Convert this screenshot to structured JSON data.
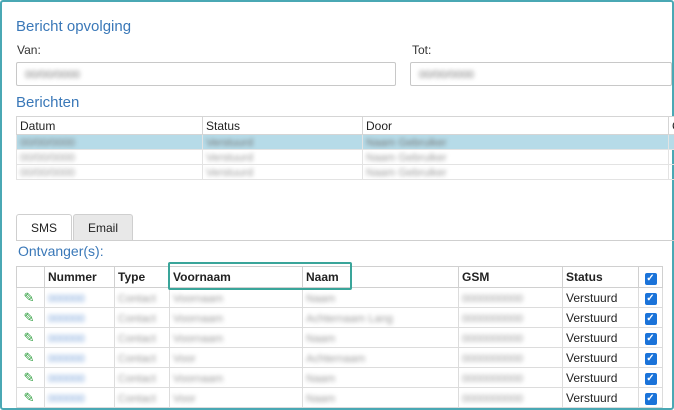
{
  "header": {
    "title": "Bericht opvolging",
    "van_label": "Van:",
    "tot_label": "Tot:",
    "van_value": "00/00/0000",
    "tot_value": "00/00/0000"
  },
  "berichten": {
    "title": "Berichten",
    "columns": [
      "Datum",
      "Status",
      "Door",
      "C"
    ],
    "rows": [
      {
        "datum": "00/00/0000",
        "status": "Verstuurd",
        "door": "Naam Gebruiker",
        "selected": true
      },
      {
        "datum": "00/00/0000",
        "status": "Verstuurd",
        "door": "Naam Gebruiker",
        "selected": false
      },
      {
        "datum": "00/00/0000",
        "status": "Verstuurd",
        "door": "Naam Gebruiker",
        "selected": false
      }
    ]
  },
  "tabs": {
    "sms": "SMS",
    "email": "Email"
  },
  "ontvangers": {
    "title": "Ontvanger(s):",
    "columns": {
      "nummer": "Nummer",
      "type": "Type",
      "voornaam": "Voornaam",
      "naam": "Naam",
      "gsm": "GSM",
      "status": "Status"
    },
    "rows": [
      {
        "nummer": "000000",
        "type": "Contact",
        "voornaam": "Voornaam",
        "naam": "Naam",
        "gsm": "0000000000",
        "status": "Verstuurd"
      },
      {
        "nummer": "000000",
        "type": "Contact",
        "voornaam": "Voornaam",
        "naam": "Achternaam Lang",
        "gsm": "0000000000",
        "status": "Verstuurd"
      },
      {
        "nummer": "000000",
        "type": "Contact",
        "voornaam": "Voornaam",
        "naam": "Naam",
        "gsm": "0000000000",
        "status": "Verstuurd"
      },
      {
        "nummer": "000000",
        "type": "Contact",
        "voornaam": "Voor",
        "naam": "Achternaam",
        "gsm": "0000000000",
        "status": "Verstuurd"
      },
      {
        "nummer": "000000",
        "type": "Contact",
        "voornaam": "Voornaam",
        "naam": "Naam",
        "gsm": "0000000000",
        "status": "Verstuurd"
      },
      {
        "nummer": "000000",
        "type": "Contact",
        "voornaam": "Voor",
        "naam": "Naam",
        "gsm": "0000000000",
        "status": "Verstuurd"
      }
    ]
  },
  "colors": {
    "accent": "#3a78b8",
    "frame": "#4aa8b4",
    "selected_row": "#b6dbe8",
    "highlight_box": "#3aa59a",
    "pencil": "#2e9e3e",
    "checkbox": "#1a73d9"
  },
  "icons": {
    "edit": "pencil-icon",
    "check": "checkbox-checked-icon"
  }
}
